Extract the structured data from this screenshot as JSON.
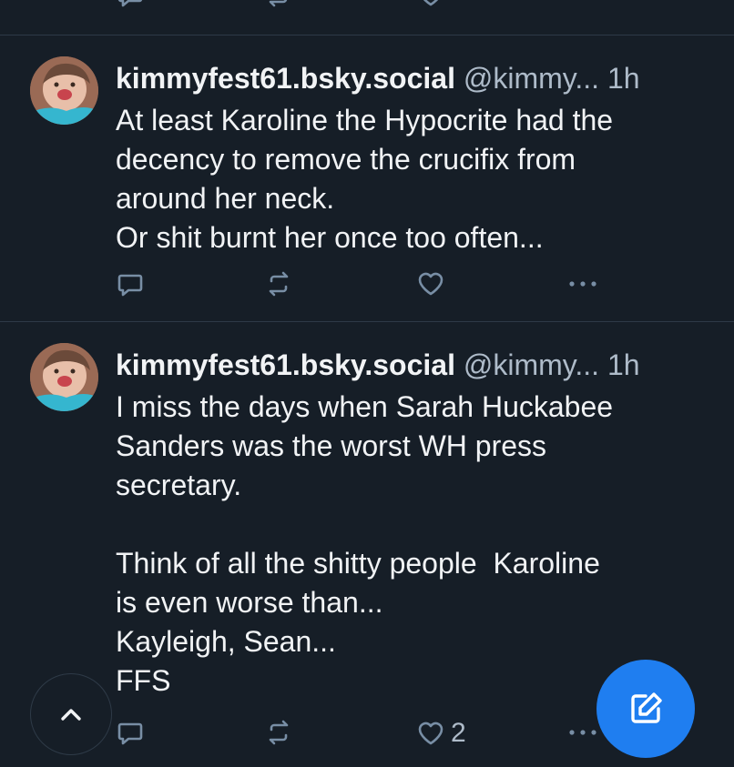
{
  "posts": [
    {
      "display_name": "kimmyfest61.bsky.social",
      "handle": "@kimmy...",
      "time": "1h",
      "text": "At least Karoline the Hypocrite had the\ndecency to remove the crucifix from\naround her neck.\nOr shit burnt her once too often...",
      "like_count": ""
    },
    {
      "display_name": "kimmyfest61.bsky.social",
      "handle": "@kimmy...",
      "time": "1h",
      "text": "I miss the days when Sarah Huckabee\nSanders was the worst WH press\nsecretary.\n\nThink of all the shitty people  Karoline\nis even worse than...\nKayleigh, Sean...\nFFS",
      "like_count": "2"
    }
  ],
  "icons": {
    "reply": "reply-icon",
    "repost": "repost-icon",
    "like": "heart-icon",
    "more": "more-icon",
    "scroll_top": "chevron-up-icon",
    "compose": "compose-icon"
  },
  "colors": {
    "background": "#161e27",
    "accent": "#1f7ef0",
    "icon": "#788ea5",
    "secondary_text": "#aebbc9"
  }
}
